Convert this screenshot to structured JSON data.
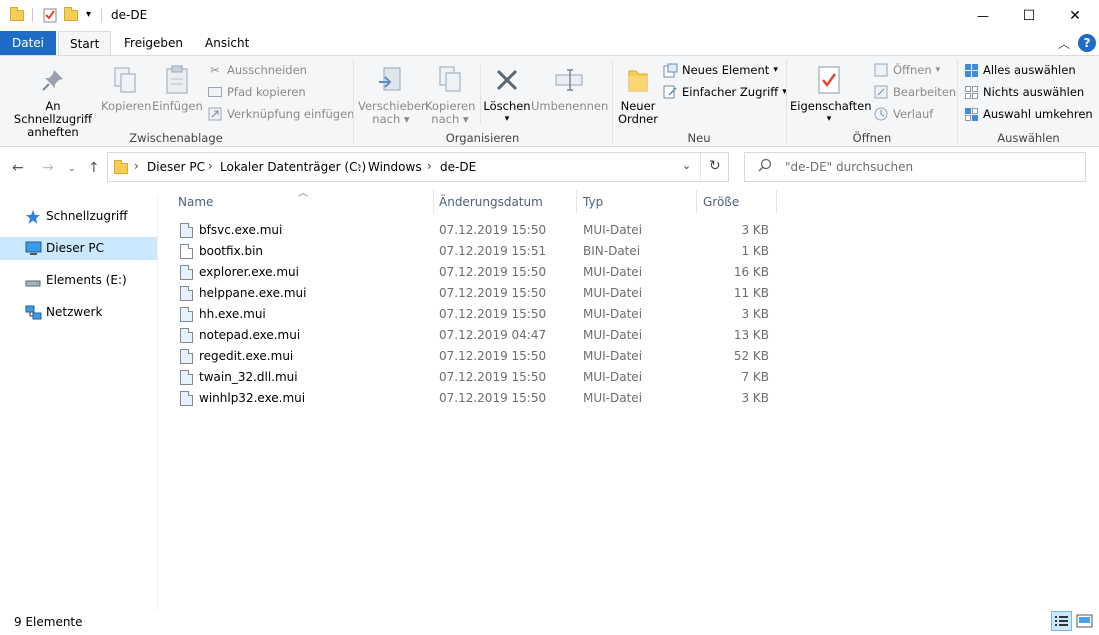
{
  "window": {
    "title": "de-DE",
    "minimize_glyph": "—",
    "maximize_glyph": "☐",
    "close_glyph": "✕"
  },
  "ribbon_tabs": [
    {
      "label": "Datei"
    },
    {
      "label": "Start"
    },
    {
      "label": "Freigeben"
    },
    {
      "label": "Ansicht"
    }
  ],
  "ribbon": {
    "clipboard": {
      "label": "Zwischenablage",
      "pin_label_1": "An Schnellzugriff",
      "pin_label_2": "anheften",
      "copy_label": "Kopieren",
      "paste_label": "Einfügen",
      "cut_label": "Ausschneiden",
      "copy_path_label": "Pfad kopieren",
      "paste_shortcut_label": "Verknüpfung einfügen"
    },
    "organize": {
      "label": "Organisieren",
      "move_label_1": "Verschieben",
      "move_label_2": "nach",
      "copyto_label_1": "Kopieren",
      "copyto_label_2": "nach",
      "delete_label": "Löschen",
      "rename_label": "Umbenennen"
    },
    "new": {
      "label": "Neu",
      "new_folder_1": "Neuer",
      "new_folder_2": "Ordner",
      "new_item_label": "Neues Element",
      "easy_access_label": "Einfacher Zugriff"
    },
    "open": {
      "label": "Öffnen",
      "properties_label": "Eigenschaften",
      "open_label": "Öffnen",
      "edit_label": "Bearbeiten",
      "history_label": "Verlauf"
    },
    "select": {
      "label": "Auswählen",
      "select_all_label": "Alles auswählen",
      "select_none_label": "Nichts auswählen",
      "invert_label": "Auswahl umkehren"
    }
  },
  "address": {
    "crumbs": [
      "Dieser PC",
      "Lokaler Datenträger (C:)",
      "Windows",
      "de-DE"
    ],
    "search_placeholder": "\"de-DE\" durchsuchen"
  },
  "nav": [
    {
      "label": "Schnellzugriff"
    },
    {
      "label": "Dieser PC"
    },
    {
      "label": "Elements (E:)"
    },
    {
      "label": "Netzwerk"
    }
  ],
  "columns": {
    "name": "Name",
    "date": "Änderungsdatum",
    "type": "Typ",
    "size": "Größe"
  },
  "files": [
    {
      "name": "bfsvc.exe.mui",
      "date": "07.12.2019 15:50",
      "type": "MUI-Datei",
      "size": "3 KB"
    },
    {
      "name": "bootfix.bin",
      "date": "07.12.2019 15:51",
      "type": "BIN-Datei",
      "size": "1 KB"
    },
    {
      "name": "explorer.exe.mui",
      "date": "07.12.2019 15:50",
      "type": "MUI-Datei",
      "size": "16 KB"
    },
    {
      "name": "helppane.exe.mui",
      "date": "07.12.2019 15:50",
      "type": "MUI-Datei",
      "size": "11 KB"
    },
    {
      "name": "hh.exe.mui",
      "date": "07.12.2019 15:50",
      "type": "MUI-Datei",
      "size": "3 KB"
    },
    {
      "name": "notepad.exe.mui",
      "date": "07.12.2019 04:47",
      "type": "MUI-Datei",
      "size": "13 KB"
    },
    {
      "name": "regedit.exe.mui",
      "date": "07.12.2019 15:50",
      "type": "MUI-Datei",
      "size": "52 KB"
    },
    {
      "name": "twain_32.dll.mui",
      "date": "07.12.2019 15:50",
      "type": "MUI-Datei",
      "size": "7 KB"
    },
    {
      "name": "winhlp32.exe.mui",
      "date": "07.12.2019 15:50",
      "type": "MUI-Datei",
      "size": "3 KB"
    }
  ],
  "status": {
    "item_count": "9 Elemente"
  }
}
